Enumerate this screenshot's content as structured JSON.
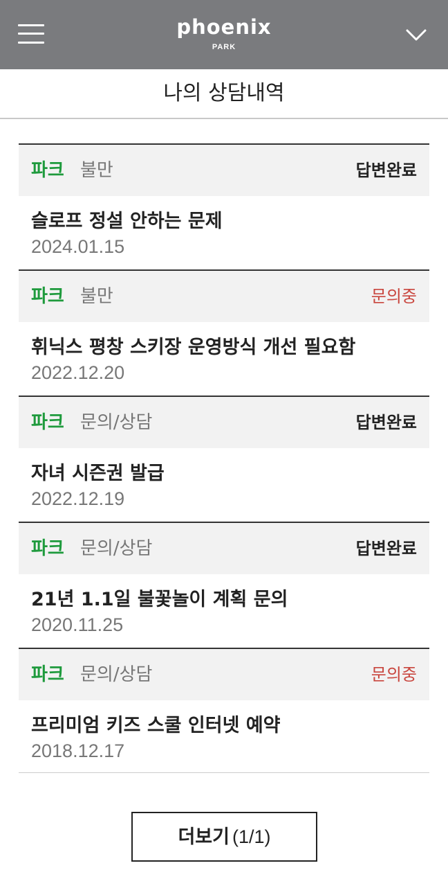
{
  "header": {
    "menu_icon": "hamburger-menu-icon",
    "logo_main": "phoenix",
    "logo_sub": "PARK",
    "chevron_icon": "chevron-down-icon"
  },
  "page": {
    "title": "나의 상담내역"
  },
  "colors": {
    "header_bg": "#7a7b7e",
    "category_green": "#1e9a3c",
    "status_pending_red": "#c9463e",
    "head_bg": "#f2f2f2"
  },
  "inquiries": [
    {
      "category": "파크",
      "type": "불만",
      "status": "답변완료",
      "subject": "슬로프 정설 안하는 문제",
      "date": "2024.01.15"
    },
    {
      "category": "파크",
      "type": "불만",
      "status": "문의중",
      "subject": "휘닉스 평창 스키장 운영방식 개선 필요함",
      "date": "2022.12.20"
    },
    {
      "category": "파크",
      "type": "문의/상담",
      "status": "답변완료",
      "subject": "자녀 시즌권 발급",
      "date": "2022.12.19"
    },
    {
      "category": "파크",
      "type": "문의/상담",
      "status": "답변완료",
      "subject": "21년 1.1일 불꽃놀이 계획 문의",
      "date": "2020.11.25"
    },
    {
      "category": "파크",
      "type": "문의/상담",
      "status": "문의중",
      "subject": "프리미엄 키즈 스쿨 인터넷 예약",
      "date": "2018.12.17"
    }
  ],
  "more": {
    "label": "더보기",
    "count": "(1/1)"
  }
}
